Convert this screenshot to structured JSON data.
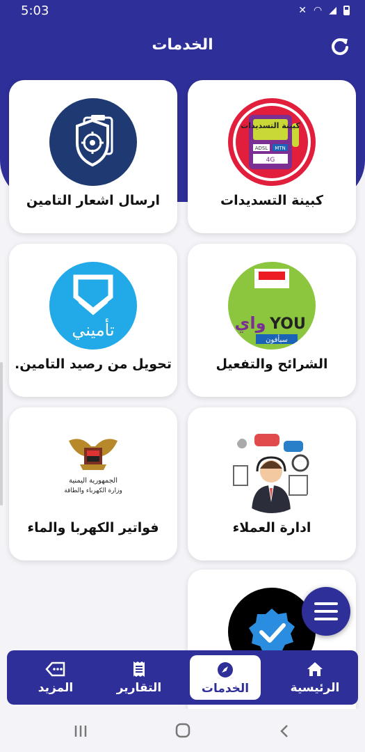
{
  "status_bar": {
    "time": "5:03"
  },
  "app_bar": {
    "title": "الخدمات"
  },
  "services": [
    {
      "label": "كبينة التسديدات",
      "logo_text": "كبينة التسديدات",
      "logo_sub": [
        "ADSL",
        "MTN",
        "4G"
      ]
    },
    {
      "label": "ارسال اشعار التامين"
    },
    {
      "label": "الشرائح والتفعيل",
      "logo_text": "YOU",
      "logo_sub": [
        "واي",
        "سبأفون"
      ]
    },
    {
      "label": "تحويل من رصيد التامين.",
      "logo_text": "تأميني"
    },
    {
      "label": "ادارة العملاء"
    },
    {
      "label": "فواتير الكهربا والماء",
      "logo_sub": [
        "الجمهورية اليمنية",
        "وزارة الكهرباء والطاقة"
      ]
    },
    {
      "label": ""
    }
  ],
  "bottom_nav": {
    "items": [
      {
        "label": "الرئيسية",
        "icon": "home-icon"
      },
      {
        "label": "الخدمات",
        "icon": "compass-icon",
        "active": true
      },
      {
        "label": "التقارير",
        "icon": "receipt-icon"
      },
      {
        "label": "المزيد",
        "icon": "tag-icon"
      }
    ]
  },
  "colors": {
    "primary": "#2f2f99",
    "background": "#f4f4f8",
    "card": "#ffffff"
  }
}
